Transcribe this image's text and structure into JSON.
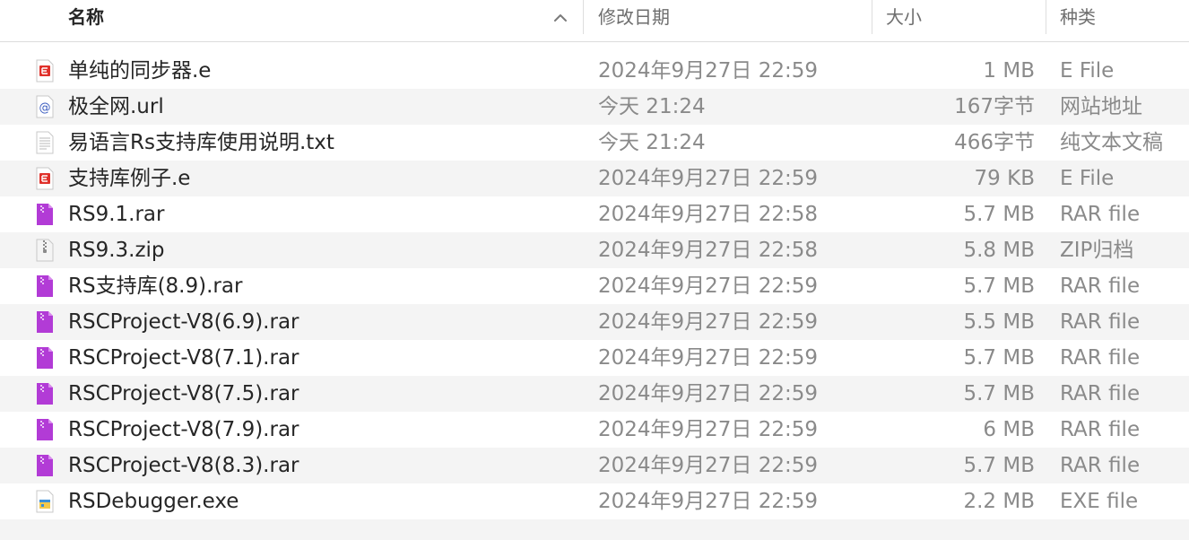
{
  "header": {
    "name_label": "名称",
    "date_label": "修改日期",
    "size_label": "大小",
    "kind_label": "种类",
    "sort_icon": "chevron-up-icon"
  },
  "rows": [
    {
      "name": "单纯的同步器.e",
      "date": "2024年9月27日 22:59",
      "size": "1 MB",
      "kind": "E File",
      "icon": "e-file-icon"
    },
    {
      "name": "极全网.url",
      "date": "今天 21:24",
      "size": "167字节",
      "kind": "网站地址",
      "icon": "url-file-icon"
    },
    {
      "name": "易语言Rs支持库使用说明.txt",
      "date": "今天 21:24",
      "size": "466字节",
      "kind": "纯文本文稿",
      "icon": "text-file-icon"
    },
    {
      "name": "支持库例子.e",
      "date": "2024年9月27日 22:59",
      "size": "79 KB",
      "kind": "E File",
      "icon": "e-file-icon"
    },
    {
      "name": "RS9.1.rar",
      "date": "2024年9月27日 22:58",
      "size": "5.7 MB",
      "kind": "RAR file",
      "icon": "rar-archive-icon"
    },
    {
      "name": "RS9.3.zip",
      "date": "2024年9月27日 22:58",
      "size": "5.8 MB",
      "kind": "ZIP归档",
      "icon": "zip-archive-icon"
    },
    {
      "name": "RS支持库(8.9).rar",
      "date": "2024年9月27日 22:59",
      "size": "5.7 MB",
      "kind": "RAR file",
      "icon": "rar-archive-icon"
    },
    {
      "name": "RSCProject-V8(6.9).rar",
      "date": "2024年9月27日 22:59",
      "size": "5.5 MB",
      "kind": "RAR file",
      "icon": "rar-archive-icon"
    },
    {
      "name": "RSCProject-V8(7.1).rar",
      "date": "2024年9月27日 22:59",
      "size": "5.7 MB",
      "kind": "RAR file",
      "icon": "rar-archive-icon"
    },
    {
      "name": "RSCProject-V8(7.5).rar",
      "date": "2024年9月27日 22:59",
      "size": "5.7 MB",
      "kind": "RAR file",
      "icon": "rar-archive-icon"
    },
    {
      "name": "RSCProject-V8(7.9).rar",
      "date": "2024年9月27日 22:59",
      "size": "6 MB",
      "kind": "RAR file",
      "icon": "rar-archive-icon"
    },
    {
      "name": "RSCProject-V8(8.3).rar",
      "date": "2024年9月27日 22:59",
      "size": "5.7 MB",
      "kind": "RAR file",
      "icon": "rar-archive-icon"
    },
    {
      "name": "RSDebugger.exe",
      "date": "2024年9月27日 22:59",
      "size": "2.2 MB",
      "kind": "EXE file",
      "icon": "exe-file-icon"
    }
  ],
  "colors": {
    "alt_row": "#f4f4f4",
    "name_text": "#262626",
    "meta_text": "#8a8a8a",
    "rar_purple": "#b23bd6",
    "e_file_red": "#e0312b"
  }
}
